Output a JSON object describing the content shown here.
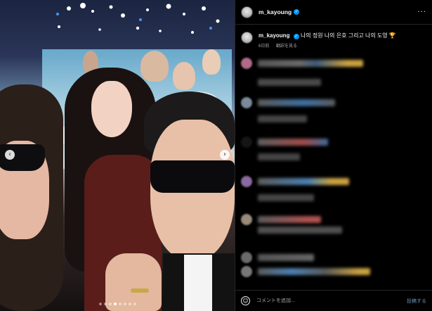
{
  "post": {
    "author": {
      "username": "m_kayoung",
      "verified": true
    },
    "caption": {
      "username": "m_kayoung",
      "text": "나의 정원 나의 은호 그리고 나의 도영",
      "emoji": "🏆",
      "time": "6日前",
      "see_translation": "翻訳を見る"
    },
    "media": {
      "prev_icon": "‹",
      "next_icon": "›",
      "carousel_count": 8,
      "carousel_active": 3
    },
    "comment_box": {
      "placeholder": "コメントを追加...",
      "post_label": "投稿する",
      "emoji_icon": "☺"
    },
    "header_more": "···"
  }
}
